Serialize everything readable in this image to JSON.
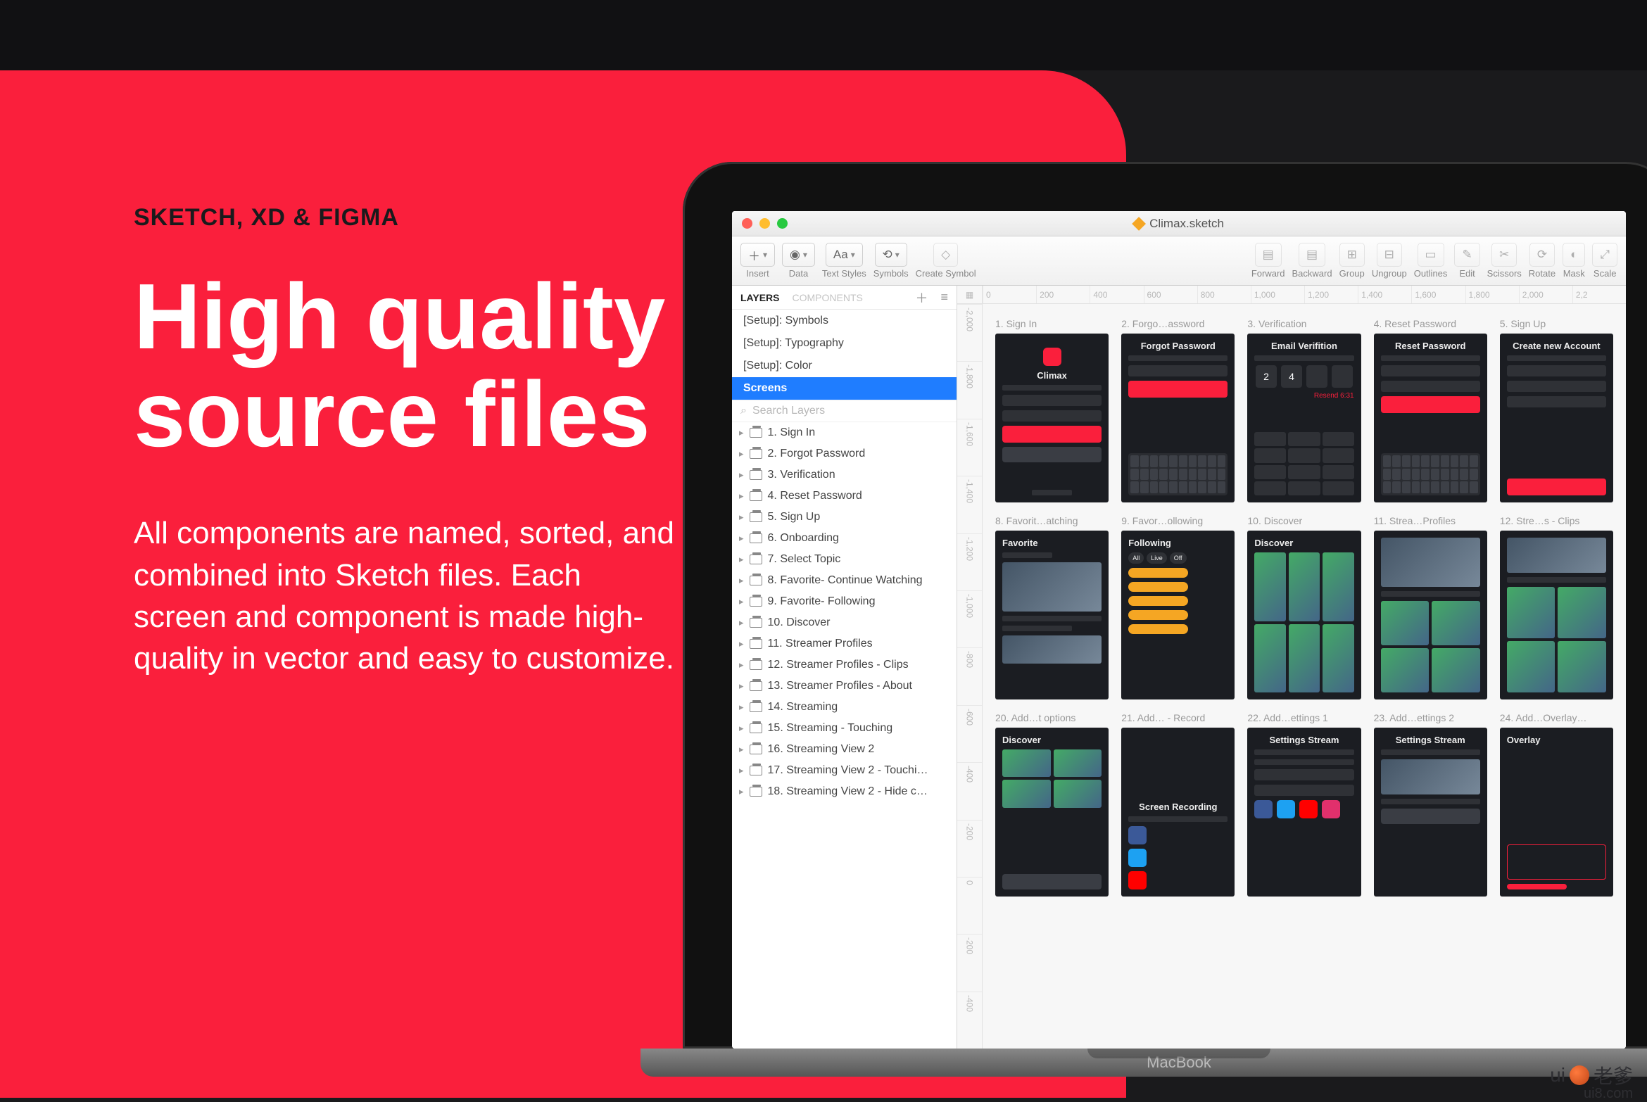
{
  "marketing": {
    "kicker": "SKETCH, XD & FIGMA",
    "headline_l1": "High quality",
    "headline_l2": "source files",
    "body": "All components are named, sorted, and combined into Sketch files. Each screen and component is made high-quality in vector and easy to customize."
  },
  "device": {
    "brand": "MacBook"
  },
  "window": {
    "title": "Climax.sketch"
  },
  "toolbar": {
    "insert": "Insert",
    "data": "Data",
    "text_styles": "Text Styles",
    "symbols": "Symbols",
    "create_symbol": "Create Symbol",
    "forward": "Forward",
    "backward": "Backward",
    "group": "Group",
    "ungroup": "Ungroup",
    "outlines": "Outlines",
    "edit": "Edit",
    "scissors": "Scissors",
    "rotate": "Rotate",
    "mask": "Mask",
    "scale": "Scale",
    "aa": "Aa",
    "arrows": "⟲"
  },
  "sidebar": {
    "tab_layers": "LAYERS",
    "tab_components": "COMPONENTS",
    "pages": {
      "symbols": "[Setup]: Symbols",
      "typography": "[Setup]: Typography",
      "color": "[Setup]: Color",
      "screens": "Screens"
    },
    "search_placeholder": "Search Layers",
    "layers": [
      "1. Sign In",
      "2. Forgot Password",
      "3. Verification",
      "4. Reset Password",
      "5. Sign Up",
      "6. Onboarding",
      "7. Select Topic",
      "8. Favorite- Continue Watching",
      "9. Favorite- Following",
      "10. Discover",
      "11. Streamer Profiles",
      "12. Streamer Profiles - Clips",
      "13. Streamer Profiles - About",
      "14. Streaming",
      "15. Streaming - Touching",
      "16. Streaming View 2",
      "17. Streaming View 2 - Touchi…",
      "18. Streaming View 2 - Hide c…"
    ]
  },
  "ruler": {
    "top": [
      "0",
      "200",
      "400",
      "600",
      "800",
      "1,000",
      "1,200",
      "1,400",
      "1,600",
      "1,800",
      "2,000",
      "2,2"
    ],
    "left": [
      "-2,000",
      "-1,800",
      "-1,600",
      "-1,400",
      "-1,200",
      "-1,000",
      "-800",
      "-600",
      "-400",
      "-200",
      "0",
      "-200",
      "-400"
    ]
  },
  "artboards": {
    "r1": [
      {
        "t": "1. Sign In",
        "k": "signin",
        "title": "Climax"
      },
      {
        "t": "2. Forgo…assword",
        "k": "forgot",
        "title": "Forgot Password"
      },
      {
        "t": "3. Verification",
        "k": "verify",
        "title": "Email Verifition"
      },
      {
        "t": "4. Reset Password",
        "k": "reset",
        "title": "Reset Password"
      },
      {
        "t": "5. Sign Up",
        "k": "signup",
        "title": "Create new Account"
      }
    ],
    "r2": [
      {
        "t": "8. Favorit…atching",
        "k": "fav1",
        "title": "Favorite"
      },
      {
        "t": "9. Favor…ollowing",
        "k": "fav2",
        "title": "Following"
      },
      {
        "t": "10. Discover",
        "k": "disc",
        "title": "Discover"
      },
      {
        "t": "11. Strea…Profiles",
        "k": "prof",
        "title": ""
      },
      {
        "t": "12. Stre…s - Clips",
        "k": "clips",
        "title": ""
      }
    ],
    "r3": [
      {
        "t": "20. Add…t options",
        "k": "opt",
        "title": "Discover"
      },
      {
        "t": "21. Add… - Record",
        "k": "rec",
        "title": "Screen Recording"
      },
      {
        "t": "22. Add…ettings 1",
        "k": "set1",
        "title": "Settings Stream"
      },
      {
        "t": "23. Add…ettings 2",
        "k": "set2",
        "title": "Settings Stream"
      },
      {
        "t": "24. Add…Overlay…",
        "k": "ovl",
        "title": "Overlay"
      }
    ]
  },
  "watermark": {
    "t1": "ui",
    "t2": "老爹",
    "url": "ui8.com"
  }
}
